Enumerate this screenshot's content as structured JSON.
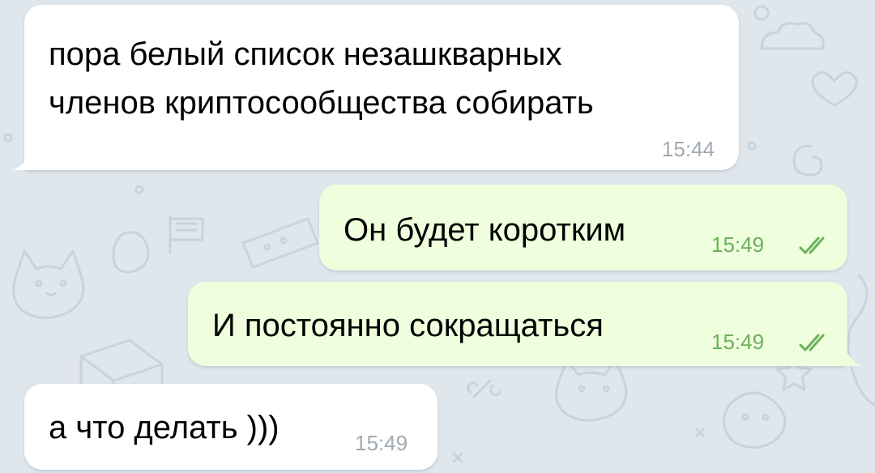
{
  "chat": {
    "messages": [
      {
        "direction": "incoming",
        "lines": [
          "пора белый список незашкварных",
          "членов криптосообщества собирать"
        ],
        "time": "15:44"
      },
      {
        "direction": "outgoing",
        "text": "Он будет коротким",
        "time": "15:49",
        "status_icon": "double-check-icon"
      },
      {
        "direction": "outgoing",
        "text": "И постоянно сокращаться",
        "time": "15:49",
        "status_icon": "double-check-icon"
      },
      {
        "direction": "incoming",
        "text": "а что делать )))",
        "time": "15:49"
      }
    ]
  },
  "colors": {
    "background": "#dfe6ec",
    "incoming_bubble": "#ffffff",
    "outgoing_bubble": "#effedd",
    "outgoing_meta": "#6cb05b",
    "incoming_meta": "#a1aab3"
  }
}
